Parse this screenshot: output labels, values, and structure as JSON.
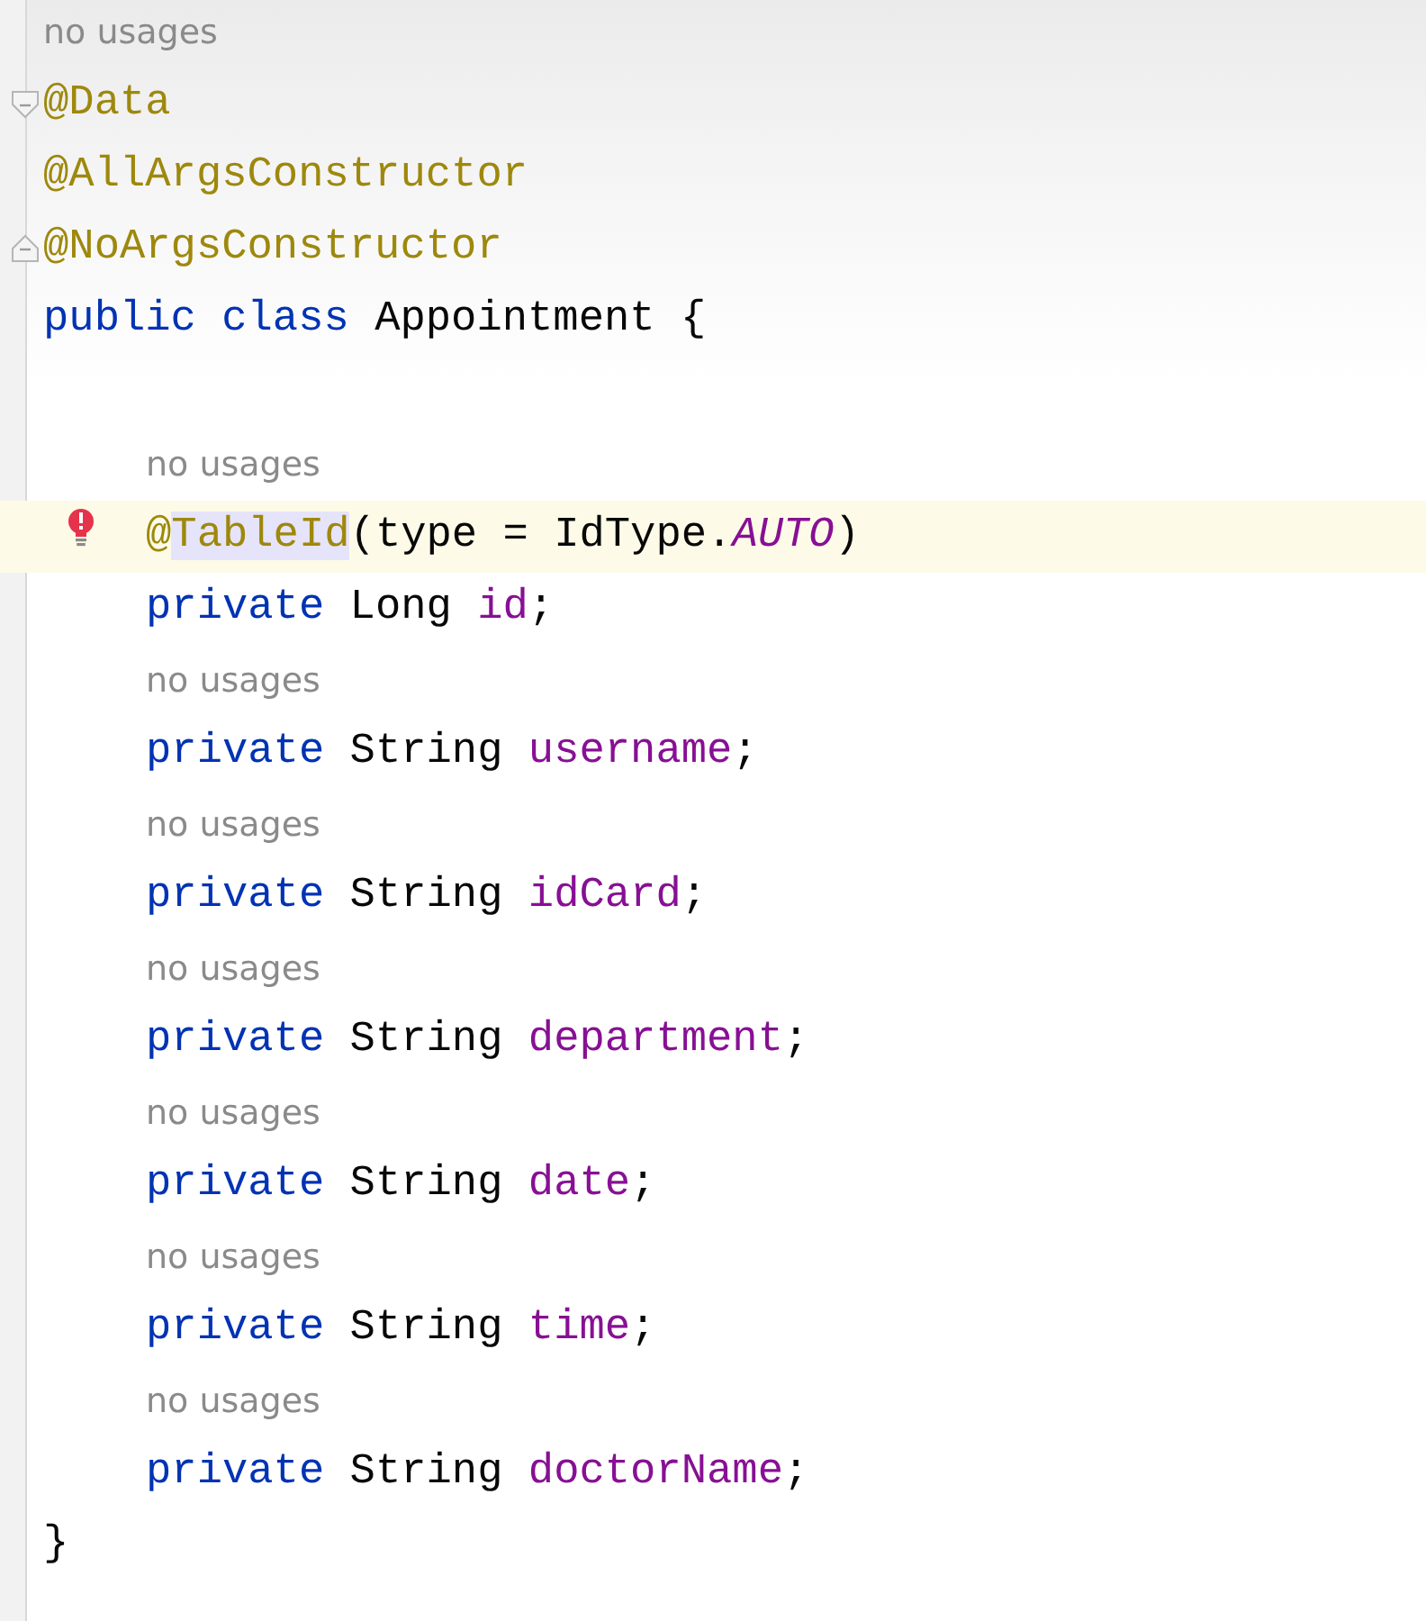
{
  "editor": {
    "lines": [
      {
        "kind": "hint",
        "text": "no usages"
      },
      {
        "kind": "code",
        "fold_start": true,
        "tokens": [
          {
            "kind": "annotation",
            "text": "@Data"
          }
        ]
      },
      {
        "kind": "code",
        "tokens": [
          {
            "kind": "annotation",
            "text": "@AllArgsConstructor"
          }
        ]
      },
      {
        "kind": "code",
        "fold_end": true,
        "tokens": [
          {
            "kind": "annotation",
            "text": "@NoArgsConstructor"
          }
        ]
      },
      {
        "kind": "code",
        "tokens": [
          {
            "kind": "keyword",
            "text": "public"
          },
          {
            "kind": "keyword",
            "text": " class"
          },
          {
            "kind": "plain",
            "text": " Appointment {"
          }
        ],
        "children": [
          {
            "kind": "blank"
          },
          {
            "kind": "hint",
            "text": "no usages"
          },
          {
            "kind": "code",
            "current": true,
            "error": true,
            "tokens": [
              {
                "kind": "annotation",
                "text": "@"
              },
              {
                "kind": "annotation",
                "text": "TableId",
                "highlighted": true
              },
              {
                "kind": "plain",
                "text": "(type = IdType."
              },
              {
                "kind": "constant",
                "text": "AUTO"
              },
              {
                "kind": "plain",
                "text": ")"
              }
            ]
          },
          {
            "kind": "code",
            "tokens": [
              {
                "kind": "keyword",
                "text": "private"
              },
              {
                "kind": "plain",
                "text": " Long "
              },
              {
                "kind": "field",
                "text": "id"
              },
              {
                "kind": "plain",
                "text": ";"
              }
            ]
          },
          {
            "kind": "hint",
            "text": "no usages"
          },
          {
            "kind": "code",
            "tokens": [
              {
                "kind": "keyword",
                "text": "private"
              },
              {
                "kind": "plain",
                "text": " String "
              },
              {
                "kind": "field",
                "text": "username"
              },
              {
                "kind": "plain",
                "text": ";"
              }
            ]
          },
          {
            "kind": "hint",
            "text": "no usages"
          },
          {
            "kind": "code",
            "tokens": [
              {
                "kind": "keyword",
                "text": "private"
              },
              {
                "kind": "plain",
                "text": " String "
              },
              {
                "kind": "field",
                "text": "idCard"
              },
              {
                "kind": "plain",
                "text": ";"
              }
            ]
          },
          {
            "kind": "hint",
            "text": "no usages"
          },
          {
            "kind": "code",
            "tokens": [
              {
                "kind": "keyword",
                "text": "private"
              },
              {
                "kind": "plain",
                "text": " String "
              },
              {
                "kind": "field",
                "text": "department"
              },
              {
                "kind": "plain",
                "text": ";"
              }
            ]
          },
          {
            "kind": "hint",
            "text": "no usages"
          },
          {
            "kind": "code",
            "tokens": [
              {
                "kind": "keyword",
                "text": "private"
              },
              {
                "kind": "plain",
                "text": " String "
              },
              {
                "kind": "field",
                "text": "date"
              },
              {
                "kind": "plain",
                "text": ";"
              }
            ]
          },
          {
            "kind": "hint",
            "text": "no usages"
          },
          {
            "kind": "code",
            "tokens": [
              {
                "kind": "keyword",
                "text": "private"
              },
              {
                "kind": "plain",
                "text": " String "
              },
              {
                "kind": "field",
                "text": "time"
              },
              {
                "kind": "plain",
                "text": ";"
              }
            ]
          },
          {
            "kind": "hint",
            "text": "no usages"
          },
          {
            "kind": "code",
            "tokens": [
              {
                "kind": "keyword",
                "text": "private"
              },
              {
                "kind": "plain",
                "text": " String "
              },
              {
                "kind": "field",
                "text": "doctorName"
              },
              {
                "kind": "plain",
                "text": ";"
              }
            ]
          }
        ]
      },
      {
        "kind": "code",
        "tokens": [
          {
            "kind": "plain",
            "text": "}"
          }
        ]
      }
    ]
  }
}
